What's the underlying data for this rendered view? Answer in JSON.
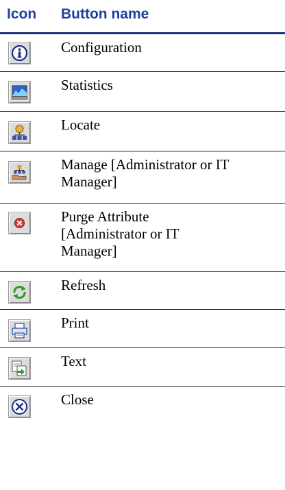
{
  "header": {
    "icon_col": "Icon",
    "name_col": "Button name"
  },
  "rows": [
    {
      "icon": "info-icon",
      "label": "Configuration"
    },
    {
      "icon": "statistics-icon",
      "label": "Statistics"
    },
    {
      "icon": "locate-icon",
      "label": "Locate"
    },
    {
      "icon": "manage-icon",
      "label": "Manage [Administrator or IT Manager]"
    },
    {
      "icon": "purge-icon",
      "label": "Purge Attribute [Administrator or IT Manager]"
    },
    {
      "icon": "refresh-icon",
      "label": "Refresh"
    },
    {
      "icon": "print-icon",
      "label": "Print"
    },
    {
      "icon": "text-icon",
      "label": "Text"
    },
    {
      "icon": "close-icon",
      "label": "Close"
    }
  ]
}
